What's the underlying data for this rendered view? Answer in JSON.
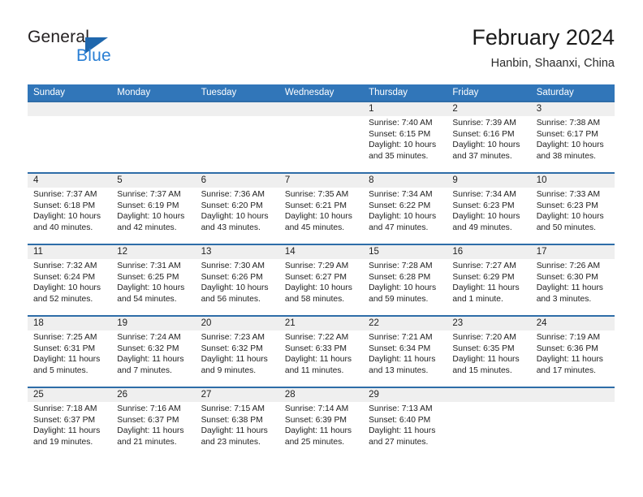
{
  "brand": {
    "name_part1": "General",
    "name_part2": "Blue",
    "flag_icon": "triangle-flag-icon"
  },
  "header": {
    "title": "February 2024",
    "location": "Hanbin, Shaanxi, China"
  },
  "colors": {
    "header_blue": "#3176b9",
    "row_divider_blue": "#2e6da8",
    "daynum_band": "#efefef",
    "brand_blue": "#2a7fd4",
    "text": "#222222"
  },
  "weekdays": [
    "Sunday",
    "Monday",
    "Tuesday",
    "Wednesday",
    "Thursday",
    "Friday",
    "Saturday"
  ],
  "weeks": [
    [
      {
        "empty": true
      },
      {
        "empty": true
      },
      {
        "empty": true
      },
      {
        "empty": true
      },
      {
        "day": "1",
        "sunrise": "Sunrise: 7:40 AM",
        "sunset": "Sunset: 6:15 PM",
        "daylight1": "Daylight: 10 hours",
        "daylight2": "and 35 minutes."
      },
      {
        "day": "2",
        "sunrise": "Sunrise: 7:39 AM",
        "sunset": "Sunset: 6:16 PM",
        "daylight1": "Daylight: 10 hours",
        "daylight2": "and 37 minutes."
      },
      {
        "day": "3",
        "sunrise": "Sunrise: 7:38 AM",
        "sunset": "Sunset: 6:17 PM",
        "daylight1": "Daylight: 10 hours",
        "daylight2": "and 38 minutes."
      }
    ],
    [
      {
        "day": "4",
        "sunrise": "Sunrise: 7:37 AM",
        "sunset": "Sunset: 6:18 PM",
        "daylight1": "Daylight: 10 hours",
        "daylight2": "and 40 minutes."
      },
      {
        "day": "5",
        "sunrise": "Sunrise: 7:37 AM",
        "sunset": "Sunset: 6:19 PM",
        "daylight1": "Daylight: 10 hours",
        "daylight2": "and 42 minutes."
      },
      {
        "day": "6",
        "sunrise": "Sunrise: 7:36 AM",
        "sunset": "Sunset: 6:20 PM",
        "daylight1": "Daylight: 10 hours",
        "daylight2": "and 43 minutes."
      },
      {
        "day": "7",
        "sunrise": "Sunrise: 7:35 AM",
        "sunset": "Sunset: 6:21 PM",
        "daylight1": "Daylight: 10 hours",
        "daylight2": "and 45 minutes."
      },
      {
        "day": "8",
        "sunrise": "Sunrise: 7:34 AM",
        "sunset": "Sunset: 6:22 PM",
        "daylight1": "Daylight: 10 hours",
        "daylight2": "and 47 minutes."
      },
      {
        "day": "9",
        "sunrise": "Sunrise: 7:34 AM",
        "sunset": "Sunset: 6:23 PM",
        "daylight1": "Daylight: 10 hours",
        "daylight2": "and 49 minutes."
      },
      {
        "day": "10",
        "sunrise": "Sunrise: 7:33 AM",
        "sunset": "Sunset: 6:23 PM",
        "daylight1": "Daylight: 10 hours",
        "daylight2": "and 50 minutes."
      }
    ],
    [
      {
        "day": "11",
        "sunrise": "Sunrise: 7:32 AM",
        "sunset": "Sunset: 6:24 PM",
        "daylight1": "Daylight: 10 hours",
        "daylight2": "and 52 minutes."
      },
      {
        "day": "12",
        "sunrise": "Sunrise: 7:31 AM",
        "sunset": "Sunset: 6:25 PM",
        "daylight1": "Daylight: 10 hours",
        "daylight2": "and 54 minutes."
      },
      {
        "day": "13",
        "sunrise": "Sunrise: 7:30 AM",
        "sunset": "Sunset: 6:26 PM",
        "daylight1": "Daylight: 10 hours",
        "daylight2": "and 56 minutes."
      },
      {
        "day": "14",
        "sunrise": "Sunrise: 7:29 AM",
        "sunset": "Sunset: 6:27 PM",
        "daylight1": "Daylight: 10 hours",
        "daylight2": "and 58 minutes."
      },
      {
        "day": "15",
        "sunrise": "Sunrise: 7:28 AM",
        "sunset": "Sunset: 6:28 PM",
        "daylight1": "Daylight: 10 hours",
        "daylight2": "and 59 minutes."
      },
      {
        "day": "16",
        "sunrise": "Sunrise: 7:27 AM",
        "sunset": "Sunset: 6:29 PM",
        "daylight1": "Daylight: 11 hours",
        "daylight2": "and 1 minute."
      },
      {
        "day": "17",
        "sunrise": "Sunrise: 7:26 AM",
        "sunset": "Sunset: 6:30 PM",
        "daylight1": "Daylight: 11 hours",
        "daylight2": "and 3 minutes."
      }
    ],
    [
      {
        "day": "18",
        "sunrise": "Sunrise: 7:25 AM",
        "sunset": "Sunset: 6:31 PM",
        "daylight1": "Daylight: 11 hours",
        "daylight2": "and 5 minutes."
      },
      {
        "day": "19",
        "sunrise": "Sunrise: 7:24 AM",
        "sunset": "Sunset: 6:32 PM",
        "daylight1": "Daylight: 11 hours",
        "daylight2": "and 7 minutes."
      },
      {
        "day": "20",
        "sunrise": "Sunrise: 7:23 AM",
        "sunset": "Sunset: 6:32 PM",
        "daylight1": "Daylight: 11 hours",
        "daylight2": "and 9 minutes."
      },
      {
        "day": "21",
        "sunrise": "Sunrise: 7:22 AM",
        "sunset": "Sunset: 6:33 PM",
        "daylight1": "Daylight: 11 hours",
        "daylight2": "and 11 minutes."
      },
      {
        "day": "22",
        "sunrise": "Sunrise: 7:21 AM",
        "sunset": "Sunset: 6:34 PM",
        "daylight1": "Daylight: 11 hours",
        "daylight2": "and 13 minutes."
      },
      {
        "day": "23",
        "sunrise": "Sunrise: 7:20 AM",
        "sunset": "Sunset: 6:35 PM",
        "daylight1": "Daylight: 11 hours",
        "daylight2": "and 15 minutes."
      },
      {
        "day": "24",
        "sunrise": "Sunrise: 7:19 AM",
        "sunset": "Sunset: 6:36 PM",
        "daylight1": "Daylight: 11 hours",
        "daylight2": "and 17 minutes."
      }
    ],
    [
      {
        "day": "25",
        "sunrise": "Sunrise: 7:18 AM",
        "sunset": "Sunset: 6:37 PM",
        "daylight1": "Daylight: 11 hours",
        "daylight2": "and 19 minutes."
      },
      {
        "day": "26",
        "sunrise": "Sunrise: 7:16 AM",
        "sunset": "Sunset: 6:37 PM",
        "daylight1": "Daylight: 11 hours",
        "daylight2": "and 21 minutes."
      },
      {
        "day": "27",
        "sunrise": "Sunrise: 7:15 AM",
        "sunset": "Sunset: 6:38 PM",
        "daylight1": "Daylight: 11 hours",
        "daylight2": "and 23 minutes."
      },
      {
        "day": "28",
        "sunrise": "Sunrise: 7:14 AM",
        "sunset": "Sunset: 6:39 PM",
        "daylight1": "Daylight: 11 hours",
        "daylight2": "and 25 minutes."
      },
      {
        "day": "29",
        "sunrise": "Sunrise: 7:13 AM",
        "sunset": "Sunset: 6:40 PM",
        "daylight1": "Daylight: 11 hours",
        "daylight2": "and 27 minutes."
      },
      {
        "empty": true
      },
      {
        "empty": true
      }
    ]
  ]
}
